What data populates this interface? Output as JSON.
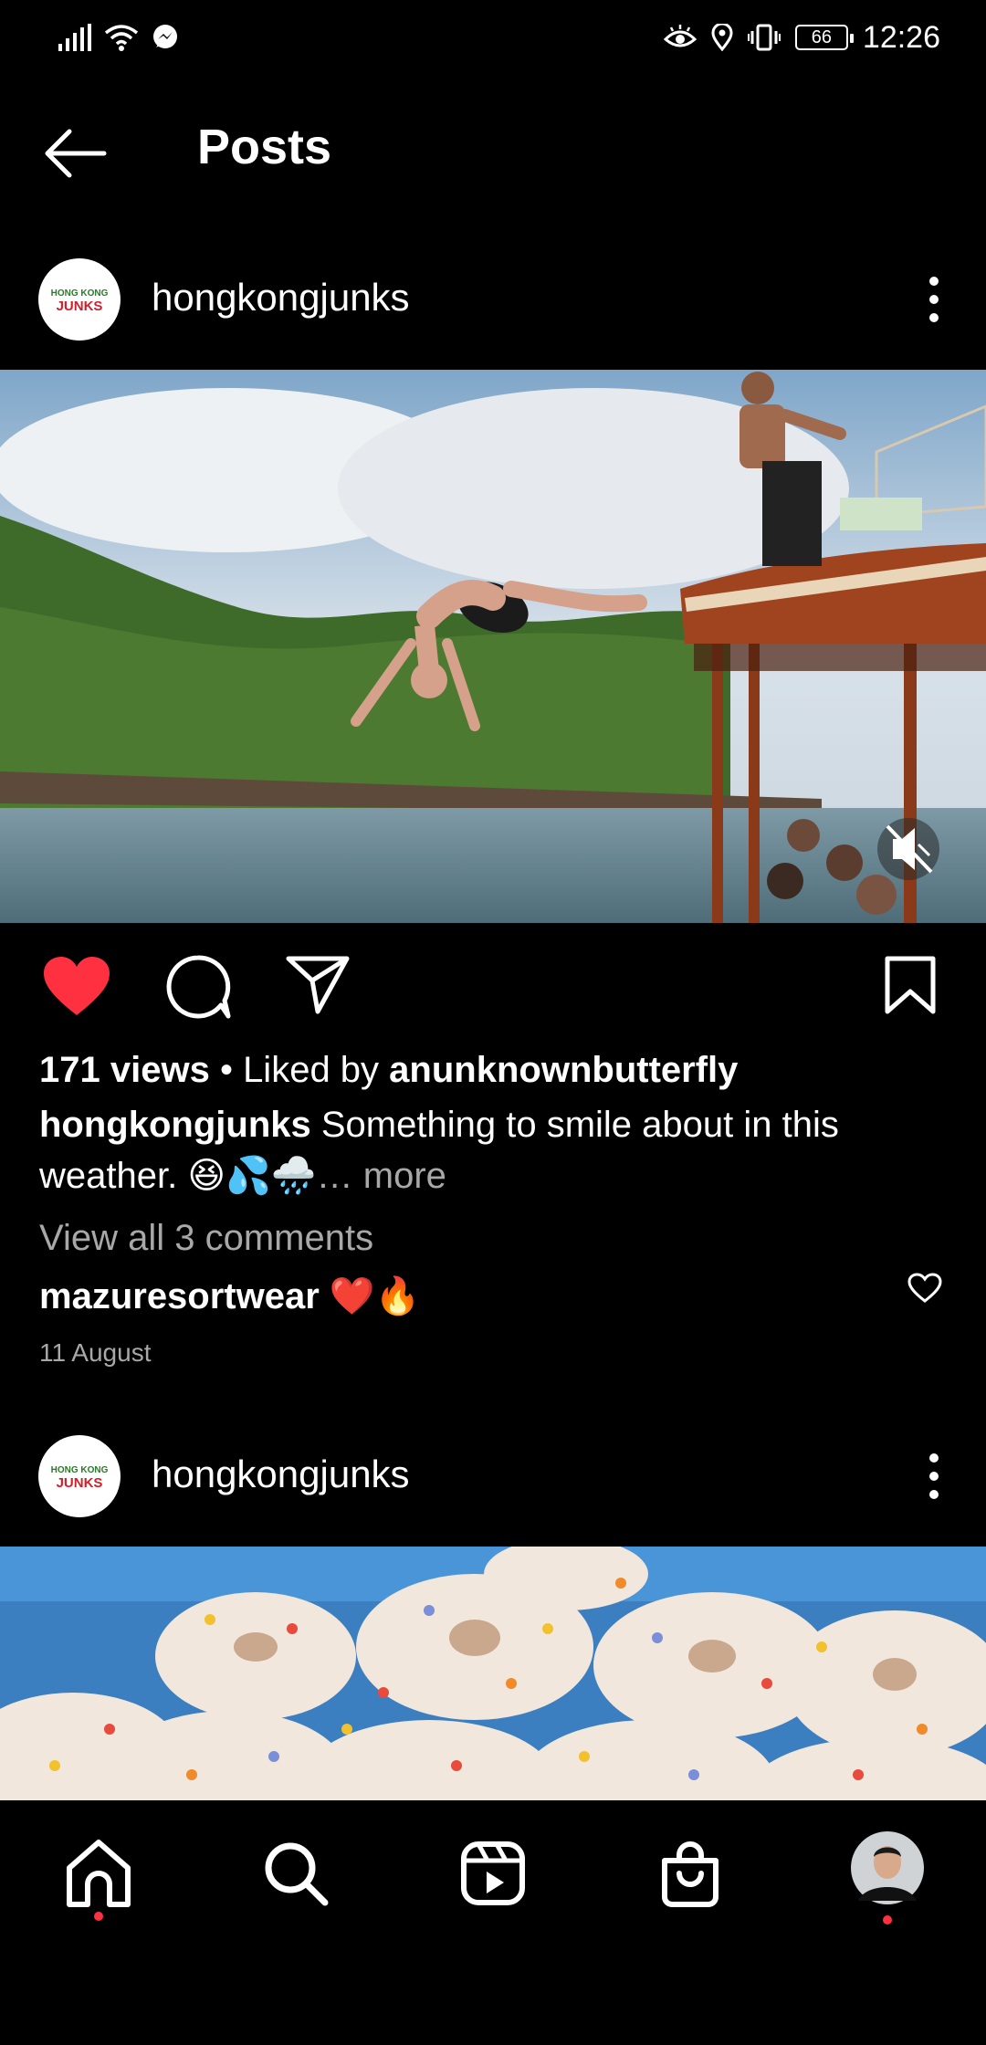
{
  "status_bar": {
    "time": "12:26",
    "battery": "66",
    "icons": [
      "signal-icon",
      "wifi-icon",
      "messenger-icon",
      "eye-comfort-icon",
      "location-icon",
      "vibrate-icon",
      "battery-icon"
    ]
  },
  "header": {
    "title": "Posts",
    "back_icon": "back-arrow-icon"
  },
  "posts": [
    {
      "username": "hongkongjunks",
      "avatar_text_top": "HONG KONG",
      "avatar_text_bottom": "JUNKS",
      "liked": true,
      "muted": true,
      "views": "171 views",
      "separator": " • ",
      "liked_by_prefix": "Liked by ",
      "liked_by_user": "anunknownbutterfly",
      "caption_user": "hongkongjunks",
      "caption_line1": " Something to smile about in this",
      "caption_line2": "weather. 😆💦🌧️",
      "caption_more": "… more",
      "view_comments": "View all 3 comments",
      "top_comment_user": "mazuresortwear",
      "top_comment_text": " ❤️🔥",
      "date": "11 August"
    },
    {
      "username": "hongkongjunks",
      "avatar_text_top": "HONG KONG",
      "avatar_text_bottom": "JUNKS"
    }
  ],
  "bottom_nav": {
    "items": [
      "home-icon",
      "search-icon",
      "reels-icon",
      "shop-icon",
      "profile-avatar"
    ]
  },
  "colors": {
    "background": "#000000",
    "like_red": "#ff3040",
    "muted_text": "#a8a8a8"
  }
}
